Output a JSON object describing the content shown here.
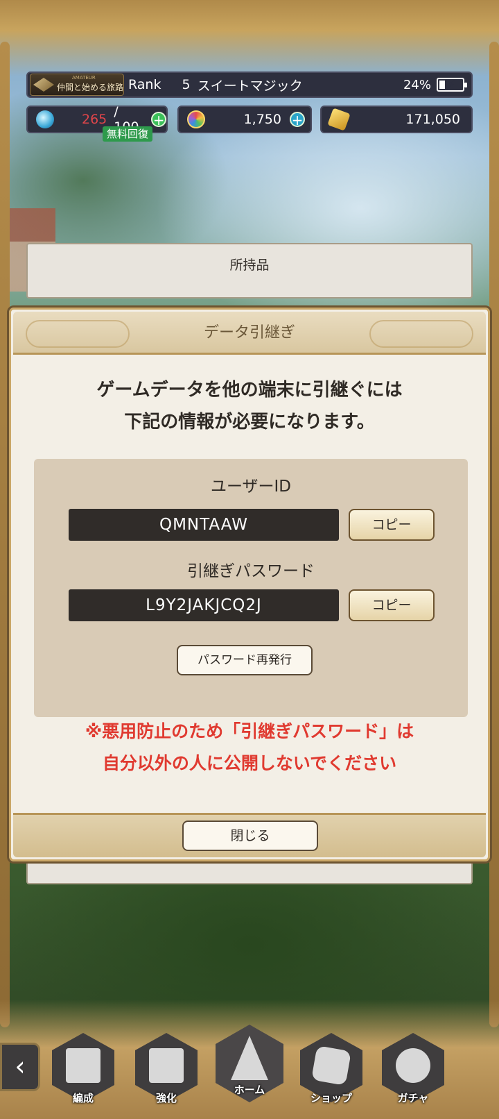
{
  "hud": {
    "rank_title": "仲間と始める旅路",
    "rank_tier": "AMATEUR",
    "rank_label": "Rank",
    "rank_level": "5",
    "player_name": "スイートマジック",
    "battery_percent": "24%",
    "stamina_current": "265",
    "stamina_max": "/ 100",
    "free_recover": "無料回復",
    "gems": "1,750",
    "coins": "171,050"
  },
  "background_panel": {
    "title": "所持品"
  },
  "modal": {
    "title": "データ引継ぎ",
    "description_line1": "ゲームデータを他の端末に引継ぐには",
    "description_line2": "下記の情報が必要になります。",
    "user_id_label": "ユーザーID",
    "user_id_value": "QMNTAAW",
    "password_label": "引継ぎパスワード",
    "password_value": "L9Y2JAKJCQ2J",
    "copy_label": "コピー",
    "reissue_label": "パスワード再発行",
    "warning_line1": "※悪用防止のため「引継ぎパスワード」は",
    "warning_line2": "自分以外の人に公開しないでください",
    "close_label": "閉じる"
  },
  "nav": {
    "back": "‹",
    "formation": "編成",
    "enhance": "強化",
    "home": "ホーム",
    "shop": "ショップ",
    "gacha": "ガチャ"
  },
  "colors": {
    "warning": "#e03a30",
    "stamina_over": "#e0454a",
    "hud_bg": "#2d2f3e",
    "field_bg": "#302c29"
  },
  "icons": {
    "stamina": "potion-icon",
    "gems": "orb-icon",
    "coins": "coin-icon",
    "battery": "battery-charging-icon"
  },
  "battery_level": 0.24
}
